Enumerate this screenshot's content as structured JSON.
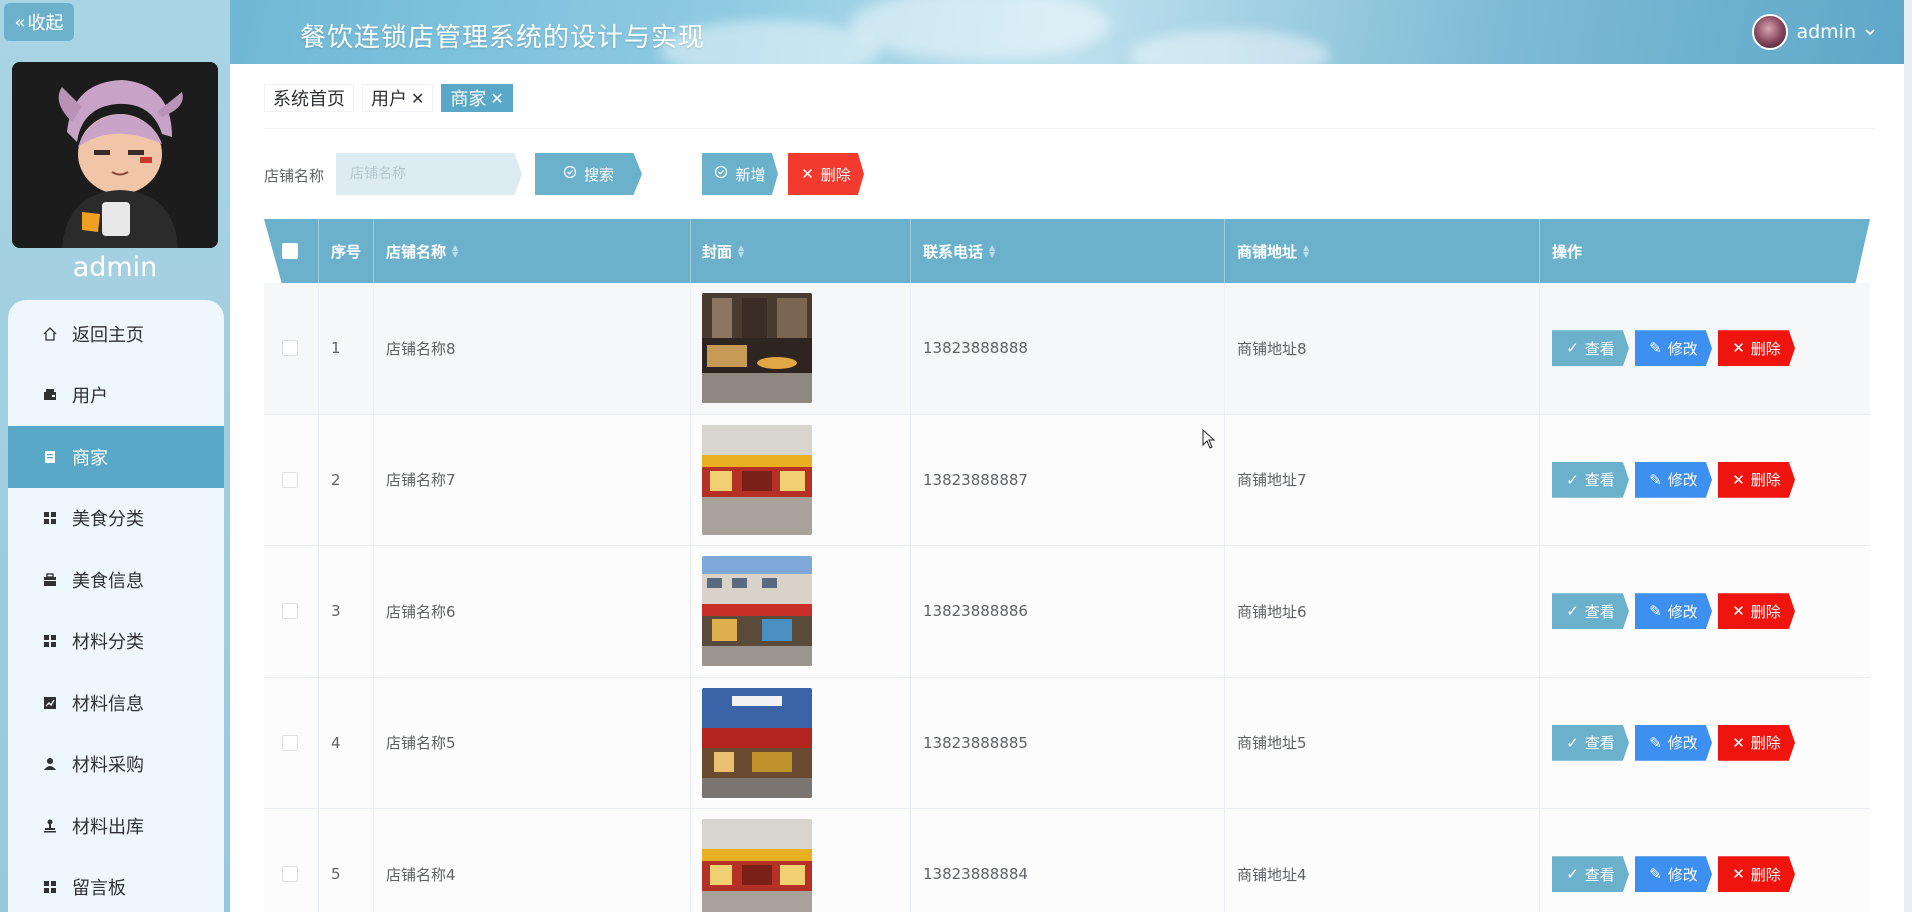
{
  "sidebar": {
    "collapse_label": "收起",
    "user_name": "admin",
    "items": [
      {
        "label": "返回主页",
        "icon": "home-icon"
      },
      {
        "label": "用户",
        "icon": "wallet-icon"
      },
      {
        "label": "商家",
        "icon": "document-icon",
        "active": true
      },
      {
        "label": "美食分类",
        "icon": "grid-icon"
      },
      {
        "label": "美食信息",
        "icon": "briefcase-icon"
      },
      {
        "label": "材料分类",
        "icon": "grid-icon"
      },
      {
        "label": "材料信息",
        "icon": "chart-icon"
      },
      {
        "label": "材料采购",
        "icon": "user-icon"
      },
      {
        "label": "材料出库",
        "icon": "stamp-icon"
      },
      {
        "label": "留言板",
        "icon": "grid-icon"
      }
    ]
  },
  "header": {
    "title": "餐饮连锁店管理系统的设计与实现",
    "user": "admin"
  },
  "tabs": [
    {
      "label": "系统首页",
      "closable": false
    },
    {
      "label": "用户",
      "closable": true
    },
    {
      "label": "商家",
      "closable": true,
      "active": true
    }
  ],
  "search": {
    "label": "店铺名称",
    "placeholder": "店铺名称",
    "search_button": "搜索",
    "add_button": "新增",
    "delete_button": "删除"
  },
  "table": {
    "columns": [
      "",
      "序号",
      "店铺名称",
      "封面",
      "联系电话",
      "商铺地址",
      "操作"
    ],
    "actions": {
      "view": "查看",
      "edit": "修改",
      "delete": "删除"
    },
    "rows": [
      {
        "index": "1",
        "name": "店铺名称8",
        "phone": "13823888888",
        "address": "商铺地址8"
      },
      {
        "index": "2",
        "name": "店铺名称7",
        "phone": "13823888887",
        "address": "商铺地址7"
      },
      {
        "index": "3",
        "name": "店铺名称6",
        "phone": "13823888886",
        "address": "商铺地址6"
      },
      {
        "index": "4",
        "name": "店铺名称5",
        "phone": "13823888885",
        "address": "商铺地址5"
      },
      {
        "index": "5",
        "name": "店铺名称4",
        "phone": "13823888884",
        "address": "商铺地址4"
      }
    ]
  },
  "colors": {
    "accent": "#6cb1cc",
    "edit": "#3d8ff0",
    "danger": "#f0140f",
    "menu_active": "#5aa8c8"
  }
}
